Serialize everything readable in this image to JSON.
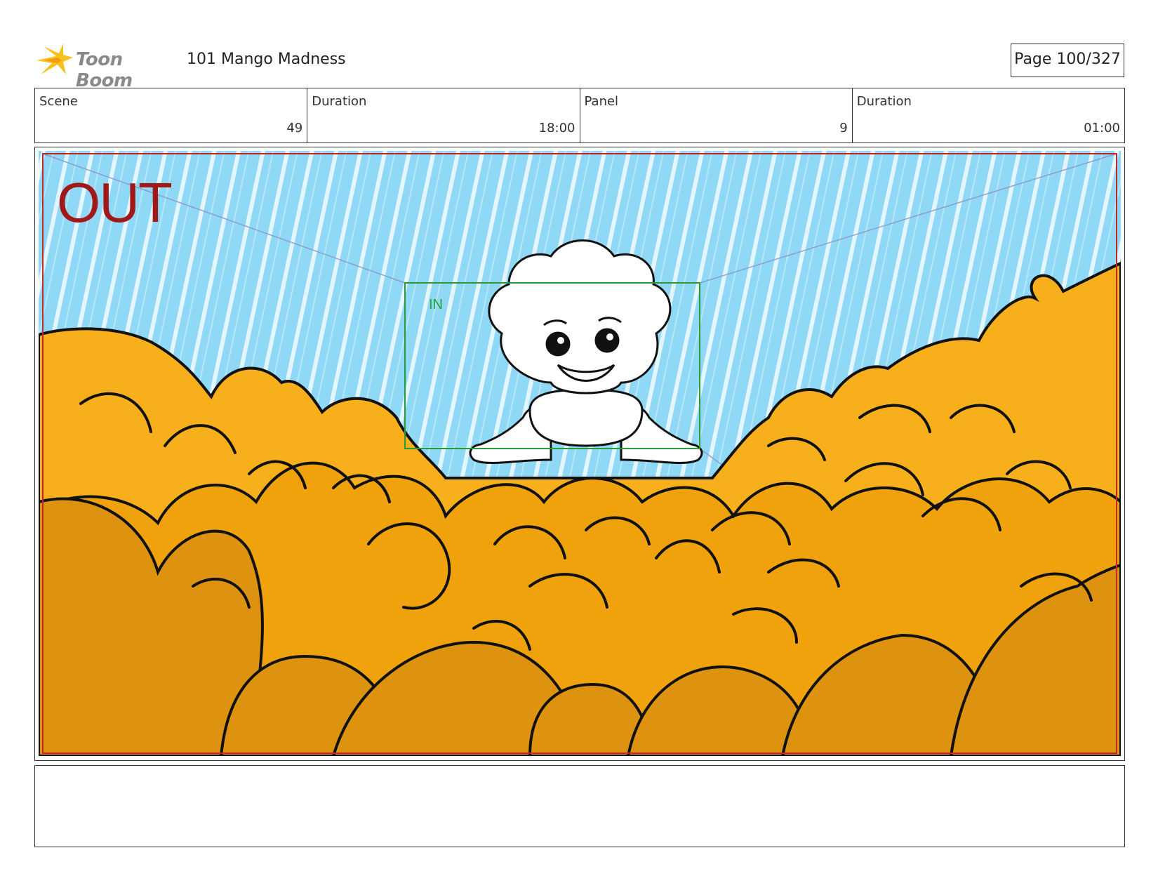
{
  "header": {
    "logo_text": "Toon Boom",
    "project_title": "101 Mango Madness",
    "page": "Page 100/327"
  },
  "info": {
    "scene_label": "Scene",
    "scene_value": "49",
    "scene_duration_label": "Duration",
    "scene_duration_value": "18:00",
    "panel_label": "Panel",
    "panel_value": "9",
    "panel_duration_label": "Duration",
    "panel_duration_value": "01:00"
  },
  "panel": {
    "out_label": "OUT",
    "in_label": "IN"
  },
  "notes": "",
  "colors": {
    "sky": "#8fd8f6",
    "sky_streak": "#ffffff",
    "mango_light": "#f7b01c",
    "mango_mid": "#f0a20c",
    "mango_dark": "#dd9310",
    "outline": "#111111",
    "out_frame": "#c0282a",
    "in_frame": "#2a9a3a",
    "guide_lines": "#8a8fc0"
  }
}
